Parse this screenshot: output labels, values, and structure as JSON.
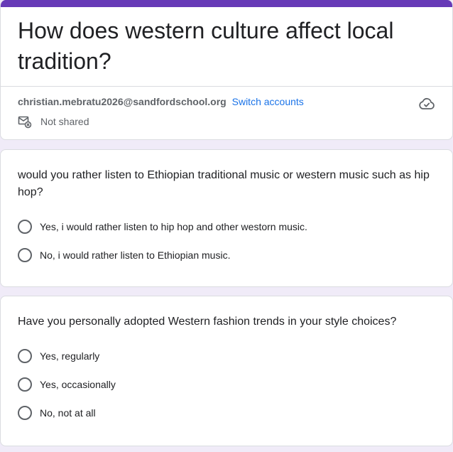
{
  "form": {
    "title": "How does western culture affect local tradition?",
    "account_email": "christian.mebratu2026@sandfordschool.org",
    "switch_accounts": "Switch accounts",
    "shared_status": "Not shared"
  },
  "questions": [
    {
      "text": "would you rather listen to Ethiopian traditional music or western music such as hip hop?",
      "options": [
        "Yes, i would rather listen to hip hop and other westorn music.",
        "No, i would rather listen to Ethiopian music."
      ]
    },
    {
      "text": "Have you personally adopted Western fashion trends in your style choices?",
      "options": [
        "Yes, regularly",
        "Yes, occasionally",
        "No, not at all"
      ]
    }
  ],
  "colors": {
    "accent": "#673ab7",
    "link": "#1a73e8",
    "background": "#f0ebf8"
  },
  "icons": {
    "cloud": "cloud-saved-icon",
    "mail": "mail-not-shared-icon"
  }
}
